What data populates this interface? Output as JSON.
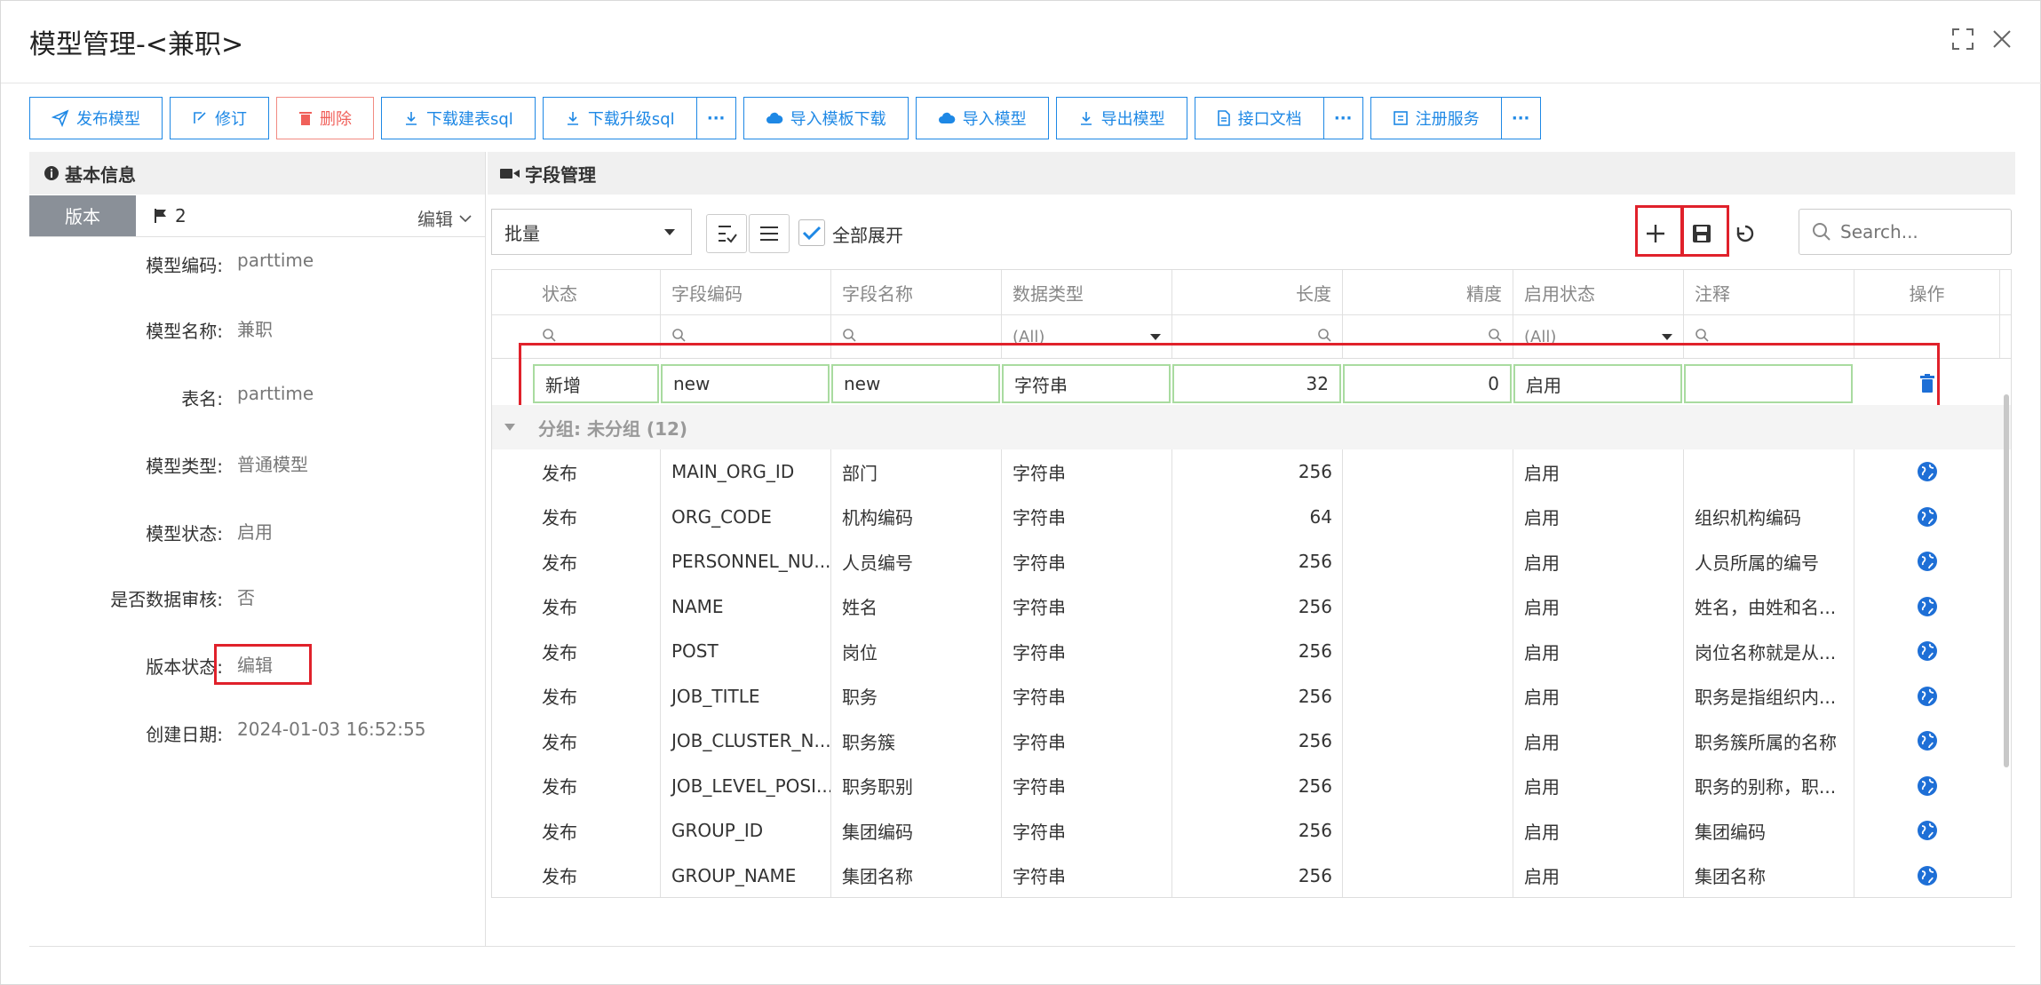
{
  "dialog": {
    "title": "模型管理-<兼职>"
  },
  "toolbar": {
    "publish": "发布模型",
    "revise": "修订",
    "delete": "删除",
    "download_create_sql": "下载建表sql",
    "download_upgrade_sql": "下载升级sql",
    "import_template_download": "导入模板下载",
    "import_model": "导入模型",
    "export_model": "导出模型",
    "api_doc": "接口文档",
    "register_service": "注册服务",
    "more": "···"
  },
  "basic_info": {
    "title": "基本信息",
    "tab_version": "版本",
    "flag_count": "2",
    "edit": "编辑",
    "fields": [
      {
        "label": "模型编码:",
        "value": "parttime"
      },
      {
        "label": "模型名称:",
        "value": "兼职"
      },
      {
        "label": "表名:",
        "value": "parttime"
      },
      {
        "label": "模型类型:",
        "value": "普通模型"
      },
      {
        "label": "模型状态:",
        "value": "启用"
      },
      {
        "label": "是否数据审核:",
        "value": "否"
      },
      {
        "label": "版本状态:",
        "value": "编辑"
      },
      {
        "label": "创建日期:",
        "value": "2024-01-03 16:52:55"
      }
    ]
  },
  "field_mgmt": {
    "title": "字段管理",
    "batch_select": "批量",
    "expand_all": "全部展开",
    "search_placeholder": "Search...",
    "columns": [
      "状态",
      "字段编码",
      "字段名称",
      "数据类型",
      "长度",
      "精度",
      "启用状态",
      "注释",
      "操作"
    ],
    "filter_all": "(All)",
    "new_row": {
      "status": "新增",
      "code": "new",
      "name": "new",
      "type": "字符串",
      "length": "32",
      "precision": "0",
      "enabled": "启用",
      "comment": ""
    },
    "group_label": "分组: 未分组 (12)",
    "rows": [
      {
        "status": "发布",
        "code": "MAIN_ORG_ID",
        "name": "部门",
        "type": "字符串",
        "length": "256",
        "precision": "",
        "enabled": "启用",
        "comment": ""
      },
      {
        "status": "发布",
        "code": "ORG_CODE",
        "name": "机构编码",
        "type": "字符串",
        "length": "64",
        "precision": "",
        "enabled": "启用",
        "comment": "组织机构编码"
      },
      {
        "status": "发布",
        "code": "PERSONNEL_NU...",
        "name": "人员编号",
        "type": "字符串",
        "length": "256",
        "precision": "",
        "enabled": "启用",
        "comment": "人员所属的编号"
      },
      {
        "status": "发布",
        "code": "NAME",
        "name": "姓名",
        "type": "字符串",
        "length": "256",
        "precision": "",
        "enabled": "启用",
        "comment": "姓名，由姓和名..."
      },
      {
        "status": "发布",
        "code": "POST",
        "name": "岗位",
        "type": "字符串",
        "length": "256",
        "precision": "",
        "enabled": "启用",
        "comment": "岗位名称就是从..."
      },
      {
        "status": "发布",
        "code": "JOB_TITLE",
        "name": "职务",
        "type": "字符串",
        "length": "256",
        "precision": "",
        "enabled": "启用",
        "comment": "职务是指组织内..."
      },
      {
        "status": "发布",
        "code": "JOB_CLUSTER_N...",
        "name": "职务簇",
        "type": "字符串",
        "length": "256",
        "precision": "",
        "enabled": "启用",
        "comment": "职务簇所属的名称"
      },
      {
        "status": "发布",
        "code": "JOB_LEVEL_POSI...",
        "name": "职务职别",
        "type": "字符串",
        "length": "256",
        "precision": "",
        "enabled": "启用",
        "comment": "职务的别称，职..."
      },
      {
        "status": "发布",
        "code": "GROUP_ID",
        "name": "集团编码",
        "type": "字符串",
        "length": "256",
        "precision": "",
        "enabled": "启用",
        "comment": "集团编码"
      },
      {
        "status": "发布",
        "code": "GROUP_NAME",
        "name": "集团名称",
        "type": "字符串",
        "length": "256",
        "precision": "",
        "enabled": "启用",
        "comment": "集团名称"
      }
    ]
  },
  "colors": {
    "accent": "#1e88e5",
    "danger": "#f0605a",
    "highlight": "#e0212b",
    "new_row_border": "#a9dba0"
  }
}
